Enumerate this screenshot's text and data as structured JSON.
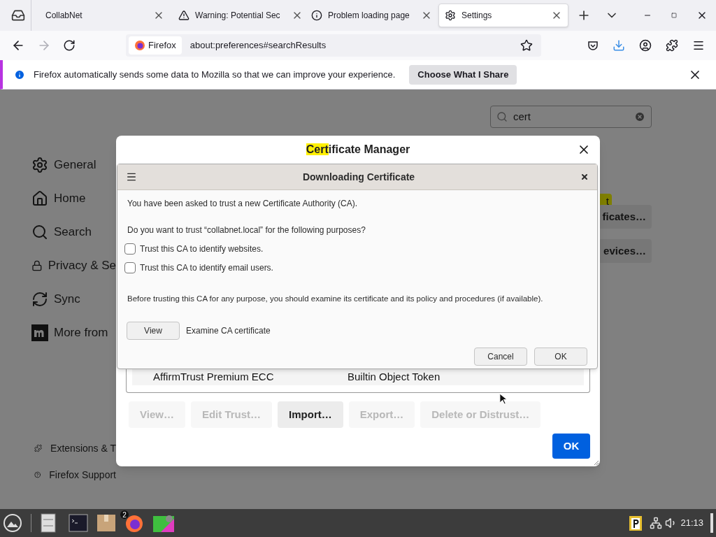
{
  "browser_tabs": [
    {
      "title": "CollabNet",
      "selected": false
    },
    {
      "title": "Warning: Potential Sec",
      "selected": false
    },
    {
      "title": "Problem loading page",
      "selected": false
    },
    {
      "title": "Settings",
      "selected": true
    }
  ],
  "address_bar": {
    "identity_label": "Firefox",
    "url": "about:preferences#searchResults"
  },
  "notification": {
    "message": "Firefox automatically sends some data to Mozilla so that we can improve your experience.",
    "button": "Choose What I Share"
  },
  "settings_search": {
    "value": "cert"
  },
  "sidebar": {
    "items": [
      {
        "label": "General"
      },
      {
        "label": "Home"
      },
      {
        "label": "Search"
      },
      {
        "label": "Privacy & Se"
      },
      {
        "label": "Sync"
      },
      {
        "label": "More from"
      }
    ],
    "footer_links": [
      {
        "label": "Extensions & T"
      },
      {
        "label": "Firefox Support"
      }
    ]
  },
  "highlight_fragment": "t",
  "background_buttons": [
    {
      "label": "ficates…"
    },
    {
      "label": "evices…"
    }
  ],
  "certificate_manager": {
    "title_parts": [
      {
        "text": "Cert",
        "highlighted": true
      },
      {
        "text": "ificate Manager",
        "highlighted": false
      }
    ],
    "table_row": {
      "name": "AffirmTrust Premium ECC",
      "token": "Builtin Object Token"
    },
    "buttons": [
      {
        "label": "View…",
        "disabled": true
      },
      {
        "label": "Edit Trust…",
        "disabled": true
      },
      {
        "label": "Import…",
        "disabled": false
      },
      {
        "label": "Export…",
        "disabled": true
      },
      {
        "label": "Delete or Distrust…",
        "disabled": true
      }
    ],
    "ok": "OK"
  },
  "download_dialog": {
    "title": "Downloading Certificate",
    "intro": "You have been asked to trust a new Certificate Authority (CA).",
    "question": "Do you want to trust “collabnet.local” for the following purposes?",
    "options": [
      {
        "label": "Trust this CA to identify websites.",
        "checked": false
      },
      {
        "label": "Trust this CA to identify email users.",
        "checked": false
      }
    ],
    "note": "Before trusting this CA for any purpose, you should examine its certificate and its policy and procedures (if available).",
    "view_button": "View",
    "view_hint": "Examine CA certificate",
    "buttons": [
      "Cancel",
      "OK"
    ]
  },
  "taskbar": {
    "notification_badge": "2",
    "clock": "21:13"
  }
}
